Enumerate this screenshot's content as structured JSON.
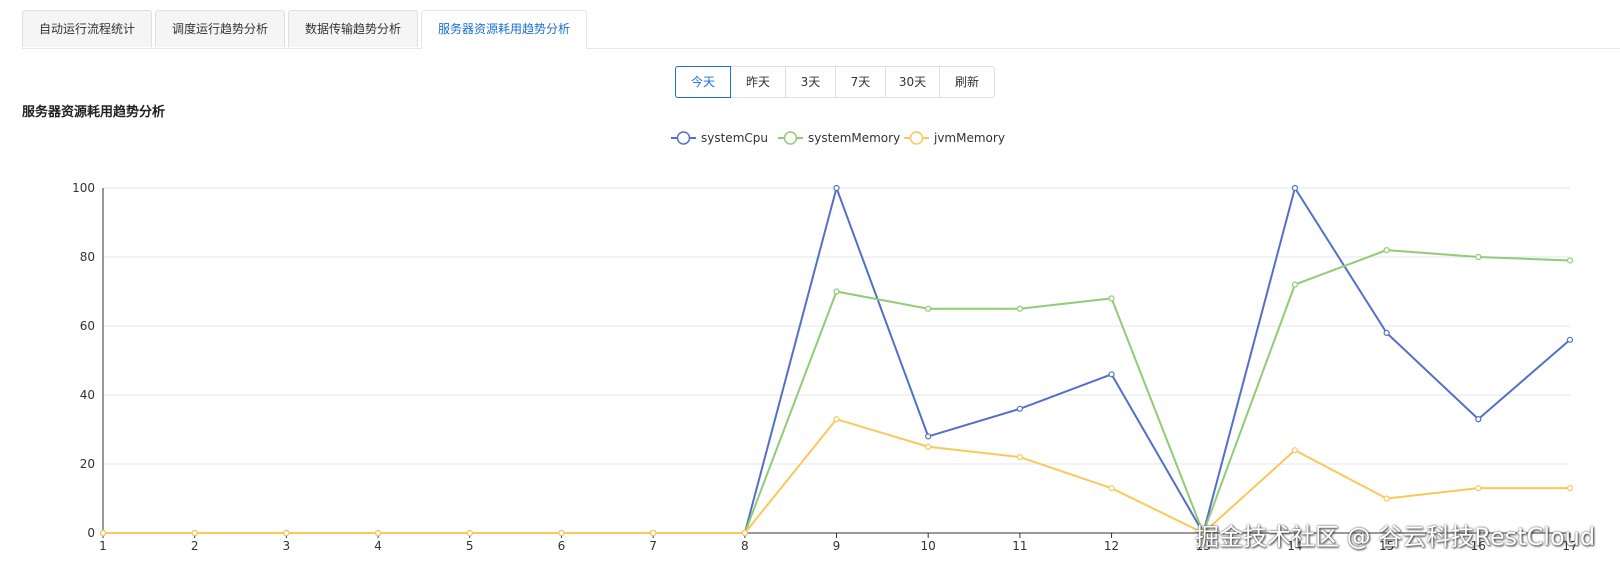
{
  "tabs": [
    {
      "label": "自动运行流程统计",
      "active": false
    },
    {
      "label": "调度运行趋势分析",
      "active": false
    },
    {
      "label": "数据传输趋势分析",
      "active": false
    },
    {
      "label": "服务器资源耗用趋势分析",
      "active": true
    }
  ],
  "range_buttons": [
    {
      "label": "今天",
      "active": true
    },
    {
      "label": "昨天",
      "active": false
    },
    {
      "label": "3天",
      "active": false
    },
    {
      "label": "7天",
      "active": false
    },
    {
      "label": "30天",
      "active": false
    },
    {
      "label": "刷新",
      "active": false
    }
  ],
  "section_title": "服务器资源耗用趋势分析",
  "watermark": "掘金技术社区 @ 谷云科技RestCloud",
  "chart_data": {
    "type": "line",
    "title": "",
    "xlabel": "",
    "ylabel": "",
    "x": [
      1,
      2,
      3,
      4,
      5,
      6,
      7,
      8,
      9,
      10,
      11,
      12,
      13,
      14,
      15,
      16,
      17
    ],
    "ylim": [
      0,
      100
    ],
    "yticks": [
      0,
      20,
      40,
      60,
      80,
      100
    ],
    "grid": true,
    "legend": "top-center",
    "series": [
      {
        "name": "systemCpu",
        "color": "#5470c6",
        "values": [
          0,
          0,
          0,
          0,
          0,
          0,
          0,
          0,
          100,
          28,
          36,
          46,
          0,
          100,
          58,
          33,
          56
        ]
      },
      {
        "name": "systemMemory",
        "color": "#91cc75",
        "values": [
          0,
          0,
          0,
          0,
          0,
          0,
          0,
          0,
          70,
          65,
          65,
          68,
          0,
          72,
          82,
          80,
          79
        ]
      },
      {
        "name": "jvmMemory",
        "color": "#fac858",
        "values": [
          0,
          0,
          0,
          0,
          0,
          0,
          0,
          0,
          33,
          25,
          22,
          13,
          0,
          24,
          10,
          13,
          13
        ]
      }
    ]
  }
}
